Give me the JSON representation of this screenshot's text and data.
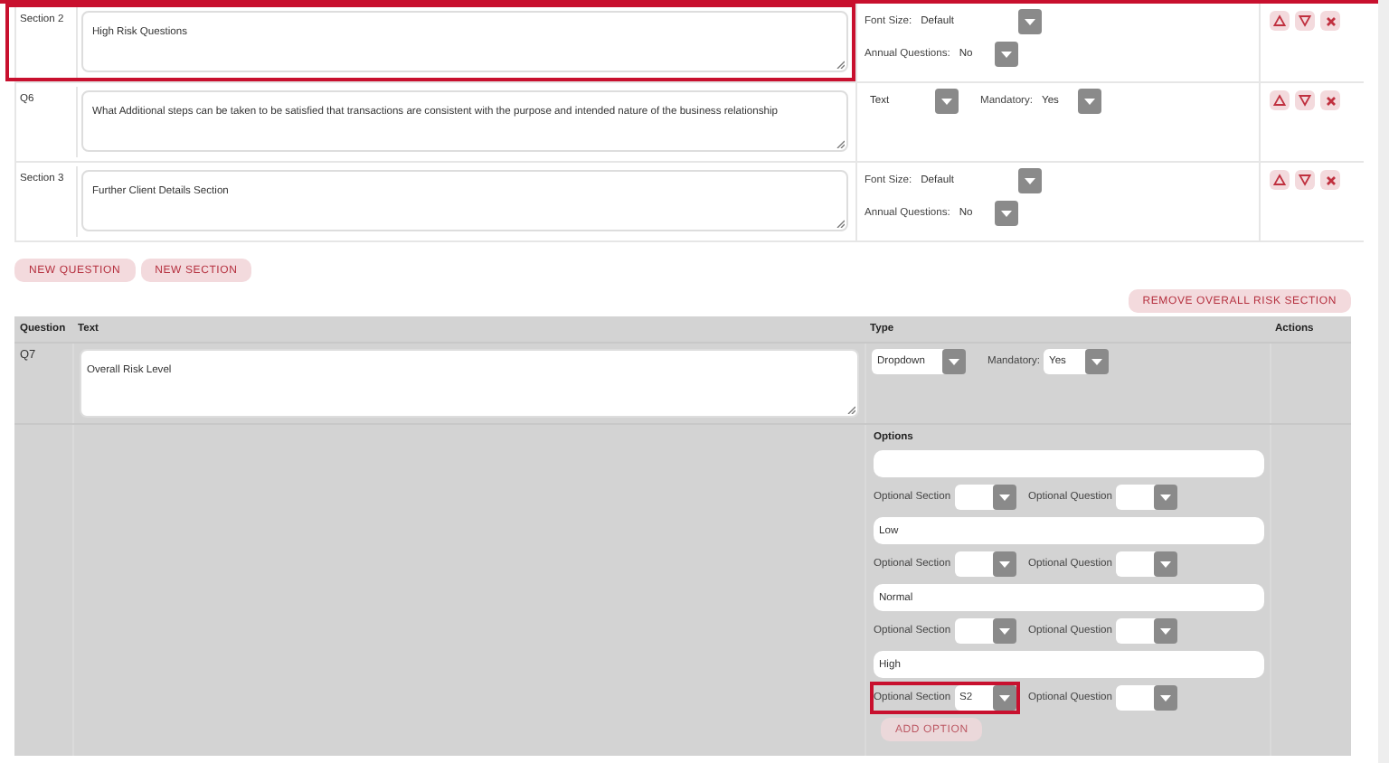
{
  "rows": [
    {
      "kind": "section",
      "label": "Section 2",
      "text": "High Risk Questions",
      "highlighted": true,
      "settings": [
        {
          "label": "Font Size:",
          "value": "Default"
        },
        {
          "label": "Annual Questions:",
          "value": "No"
        }
      ]
    },
    {
      "kind": "question",
      "label": "Q6",
      "text": "What Additional steps can be taken to be satisfied that transactions are consistent with the purpose and intended nature of the business relationship",
      "highlighted": false,
      "settings": [
        {
          "value": "Text"
        },
        {
          "label": "Mandatory:",
          "value": "Yes"
        }
      ]
    },
    {
      "kind": "section",
      "label": "Section 3",
      "text": "Further Client Details Section",
      "highlighted": false,
      "settings": [
        {
          "label": "Font Size:",
          "value": "Default"
        },
        {
          "label": "Annual Questions:",
          "value": "No"
        }
      ]
    }
  ],
  "buttons": [
    "NEW QUESTION",
    "NEW SECTION"
  ],
  "remove_button": "REMOVE OVERALL RISK SECTION",
  "risk_table": {
    "columns": [
      "Question",
      "Text",
      "Type",
      "Actions"
    ],
    "question": {
      "label": "Q7",
      "text": "Overall Risk Level",
      "settings": [
        {
          "value": "Dropdown"
        },
        {
          "label": "Mandatory:",
          "value": "Yes"
        }
      ]
    },
    "options_label": "Options",
    "options": [
      {
        "section_label": "Optional Section",
        "question_label": "Optional Question",
        "highlighted": false
      },
      {
        "value": "Low",
        "section_label": "Optional Section",
        "question_label": "Optional Question",
        "highlighted": false
      },
      {
        "value": "Normal",
        "section_label": "Optional Section",
        "question_label": "Optional Question",
        "highlighted": false
      },
      {
        "value": "High",
        "section_label": "Optional Section",
        "section_value": "S2",
        "question_label": "Optional Question",
        "highlighted": true
      }
    ],
    "add_option": "ADD OPTION"
  }
}
